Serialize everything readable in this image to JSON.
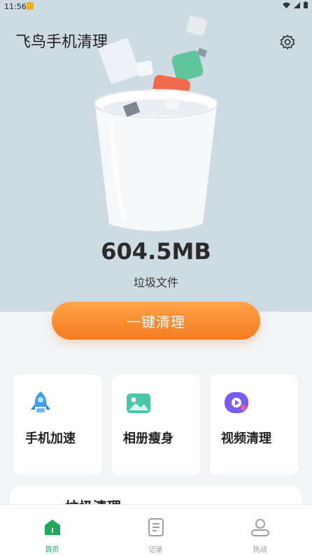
{
  "status_bar": {
    "time": "11:56"
  },
  "header": {
    "title": "飞鸟手机清理"
  },
  "summary": {
    "size": "604.5MB",
    "label": "垃圾文件"
  },
  "clean_button": {
    "label": "一键清理"
  },
  "features": [
    {
      "label": "手机加速",
      "icon": "rocket-icon"
    },
    {
      "label": "相册瘦身",
      "icon": "photo-icon"
    },
    {
      "label": "视频清理",
      "icon": "video-icon"
    }
  ],
  "junk_panel": {
    "title": "垃圾清理"
  },
  "tabs": [
    {
      "label": "首页",
      "icon": "home-icon",
      "active": true
    },
    {
      "label": "记录",
      "icon": "document-icon",
      "active": false
    },
    {
      "label": "挑战",
      "icon": "user-icon",
      "active": false
    }
  ],
  "colors": {
    "accent": "#f47a20",
    "active_tab": "#1fa85a",
    "hero_bg": "#cfdbe3"
  }
}
